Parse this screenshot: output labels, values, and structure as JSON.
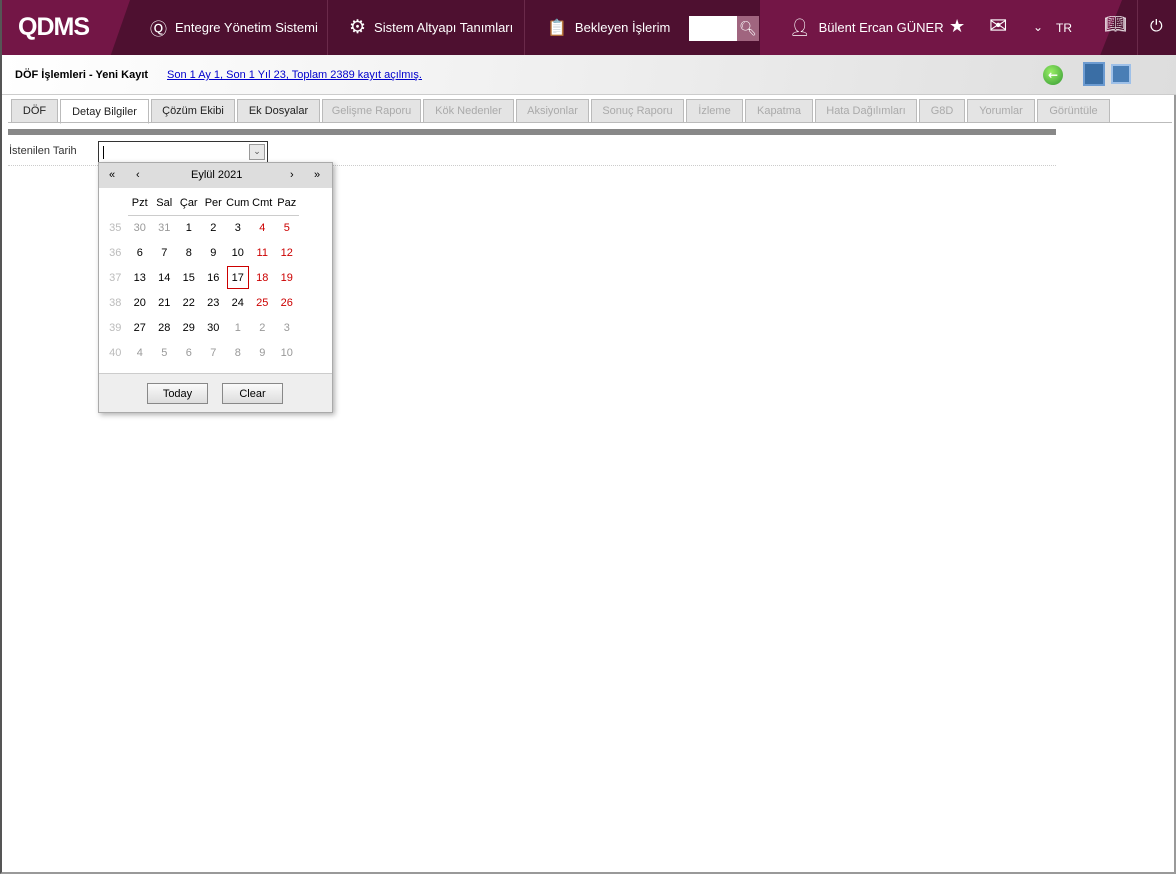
{
  "header": {
    "logo": "QDMS",
    "nav": [
      "Entegre Yönetim Sistemi",
      "Sistem Altyapı Tanımları",
      "Bekleyen İşlerim"
    ],
    "user": "Bülent Ercan GÜNER",
    "lang": "TR"
  },
  "sub": {
    "title": "DÖF İşlemleri - Yeni Kayıt",
    "stats": "Son 1 Ay 1, Son 1 Yıl 23, Toplam 2389 kayıt açılmış."
  },
  "tabs": [
    "DÖF",
    "Detay Bilgiler",
    "Çözüm Ekibi",
    "Ek Dosyalar",
    "Gelişme Raporu",
    "Kök Nedenler",
    "Aksiyonlar",
    "Sonuç Raporu",
    "İzleme",
    "Kapatma",
    "Hata Dağılımları",
    "G8D",
    "Yorumlar",
    "Görüntüle"
  ],
  "form": {
    "label": "İstenilen Tarih",
    "value": ""
  },
  "calendar": {
    "title": "Eylül 2021",
    "first": "«",
    "prev": "‹",
    "next": "›",
    "last": "»",
    "days": [
      "Pzt",
      "Sal",
      "Çar",
      "Per",
      "Cum",
      "Cmt",
      "Paz"
    ],
    "weeks": [
      {
        "wk": "35",
        "d": [
          "30",
          "31",
          "1",
          "2",
          "3",
          "4",
          "5"
        ]
      },
      {
        "wk": "36",
        "d": [
          "6",
          "7",
          "8",
          "9",
          "10",
          "11",
          "12"
        ]
      },
      {
        "wk": "37",
        "d": [
          "13",
          "14",
          "15",
          "16",
          "17",
          "18",
          "19"
        ]
      },
      {
        "wk": "38",
        "d": [
          "20",
          "21",
          "22",
          "23",
          "24",
          "25",
          "26"
        ]
      },
      {
        "wk": "39",
        "d": [
          "27",
          "28",
          "29",
          "30",
          "1",
          "2",
          "3"
        ]
      },
      {
        "wk": "40",
        "d": [
          "4",
          "5",
          "6",
          "7",
          "8",
          "9",
          "10"
        ]
      }
    ],
    "today": "17",
    "today_label": "Today",
    "clear_label": "Clear"
  }
}
